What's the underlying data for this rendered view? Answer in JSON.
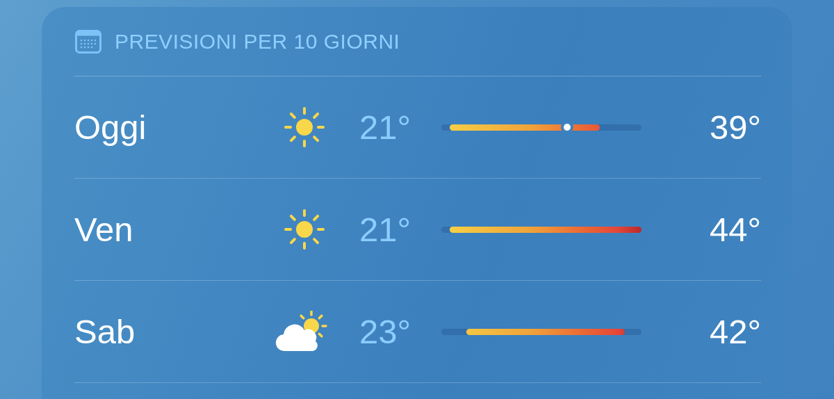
{
  "header": {
    "title": "PREVISIONI PER 10 GIORNI"
  },
  "days": [
    {
      "day": "Oggi",
      "kind": "sun",
      "low": "21°",
      "high": "39°",
      "now": {
        "level": 0.63
      }
    },
    {
      "day": "Ven",
      "kind": "sun",
      "low": "21°",
      "high": "44°"
    },
    {
      "day": "Sab",
      "kind": "partly-cloudy",
      "low": "23°",
      "high": "42°"
    }
  ]
}
